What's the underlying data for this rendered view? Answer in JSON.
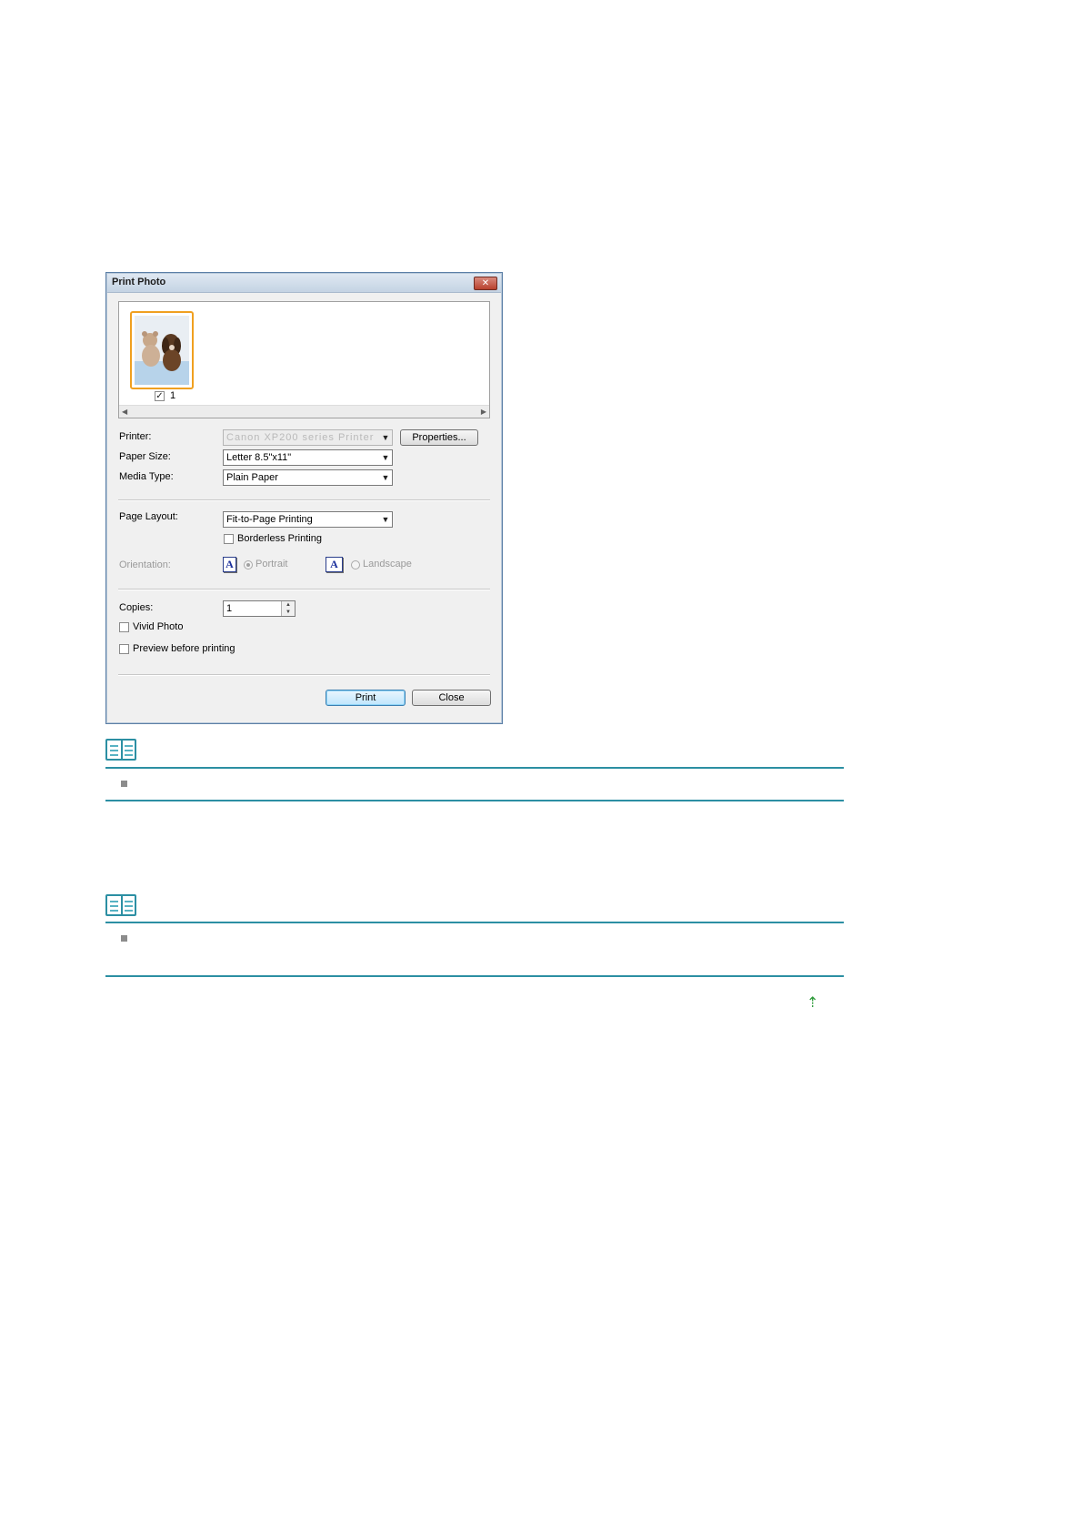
{
  "dialog": {
    "title": "Print Photo",
    "close_glyph": "✕",
    "thumbnail": {
      "number": "1",
      "checked": true
    },
    "printer": {
      "label": "Printer:",
      "value": "Canon XP200 series Printer",
      "properties_label": "Properties..."
    },
    "paper_size": {
      "label": "Paper Size:",
      "value": "Letter 8.5\"x11\""
    },
    "media_type": {
      "label": "Media Type:",
      "value": "Plain Paper"
    },
    "page_layout": {
      "label": "Page Layout:",
      "value": "Fit-to-Page Printing"
    },
    "borderless": {
      "label": "Borderless Printing",
      "checked": false
    },
    "orientation": {
      "label": "Orientation:",
      "portrait_label": "Portrait",
      "landscape_label": "Landscape",
      "selected": "Portrait",
      "icon_letter": "A"
    },
    "copies": {
      "label": "Copies:",
      "value": "1"
    },
    "vivid_photo": {
      "label": "Vivid Photo",
      "checked": false
    },
    "preview": {
      "label": "Preview before printing",
      "checked": false
    },
    "print_label": "Print",
    "close_label": "Close"
  },
  "notes": [
    {
      "icon": "note-book-icon",
      "items": [
        ""
      ]
    },
    {
      "icon": "note-book-icon",
      "items": [
        ""
      ]
    }
  ],
  "back_to_top_icon": "up-arrow-icon",
  "colors": {
    "accent": "#2c8fa3",
    "thumbnail_border": "#f0a020",
    "back_to_top": "#2e9a3a"
  }
}
